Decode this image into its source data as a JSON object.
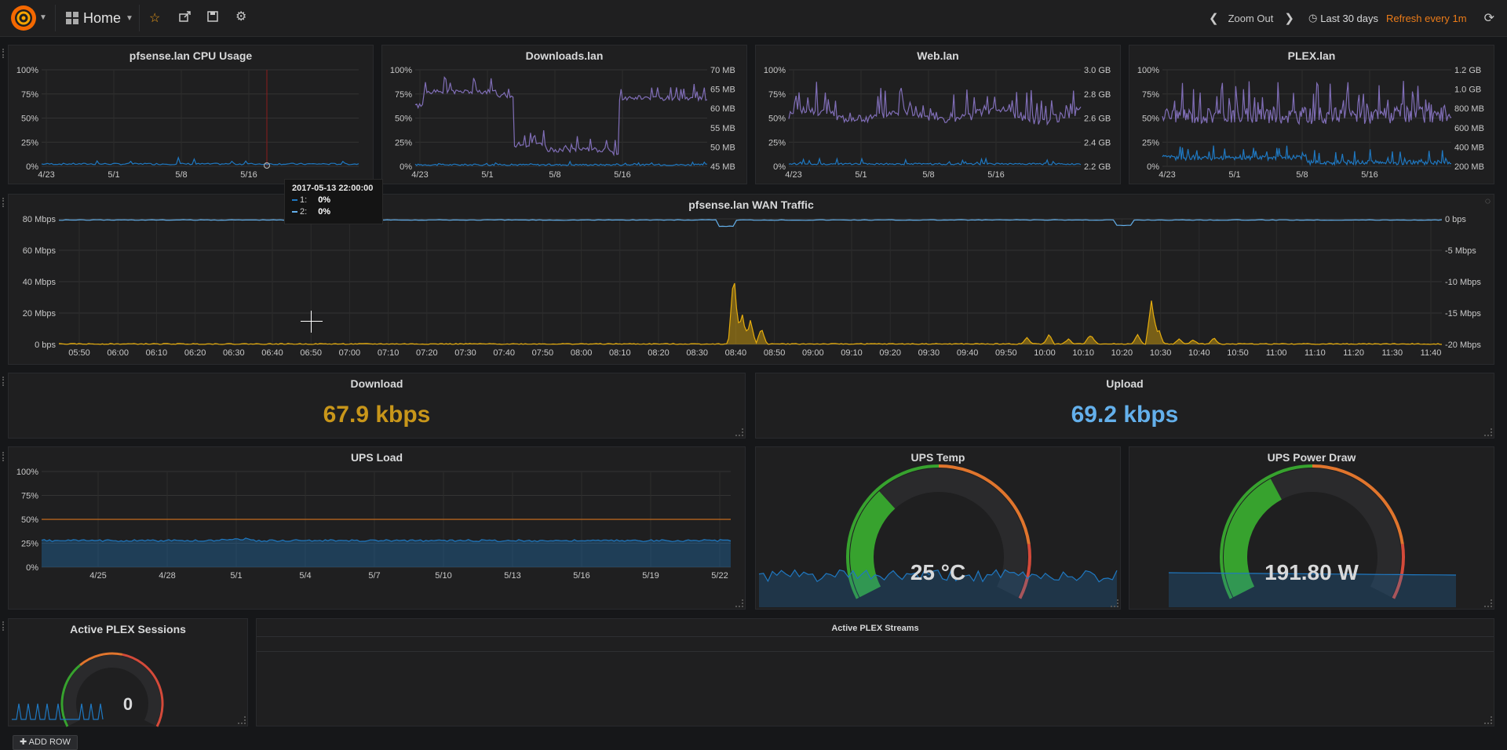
{
  "nav": {
    "dashboard_title": "Home",
    "zoom_out_label": "Zoom Out",
    "time_range": "Last 30 days",
    "refresh": "Refresh every 1m"
  },
  "icons": {
    "logo": "grafana-logo",
    "star": "star-icon",
    "share": "share-icon",
    "save": "save-icon",
    "settings": "gear-icon",
    "prev": "chevron-left-icon",
    "next": "chevron-right-icon",
    "clock": "clock-icon",
    "reload": "refresh-icon"
  },
  "colors": {
    "background": "#161719",
    "panel": "#1f1f20",
    "blue": "#1f78c1",
    "light_blue": "#64b0eb",
    "purple": "#806eb7",
    "yellow": "#e5ac0e",
    "orange": "#eb7b18",
    "gauge_green": "#37a22e",
    "gauge_orange": "#e0752d",
    "gauge_red": "#d44a3a",
    "download_stat": "#c8961a",
    "upload_stat": "#64b0eb"
  },
  "panels": {
    "cpu": {
      "title": "pfsense.lan CPU Usage",
      "y_ticks": [
        "100%",
        "75%",
        "50%",
        "25%",
        "0%"
      ],
      "x_ticks": [
        "4/23",
        "5/1",
        "5/8",
        "5/16"
      ]
    },
    "downloads": {
      "title": "Downloads.lan",
      "y_ticks": [
        "100%",
        "75%",
        "50%",
        "25%",
        "0%"
      ],
      "y2_ticks": [
        "70 MB",
        "65 MB",
        "60 MB",
        "55 MB",
        "50 MB",
        "45 MB"
      ],
      "x_ticks": [
        "4/23",
        "5/1",
        "5/8",
        "5/16"
      ]
    },
    "web": {
      "title": "Web.lan",
      "y_ticks": [
        "100%",
        "75%",
        "50%",
        "25%",
        "0%"
      ],
      "y2_ticks": [
        "3.0 GB",
        "2.8 GB",
        "2.6 GB",
        "2.4 GB",
        "2.2 GB"
      ],
      "x_ticks": [
        "4/23",
        "5/1",
        "5/8",
        "5/16"
      ]
    },
    "plex": {
      "title": "PLEX.lan",
      "y_ticks": [
        "100%",
        "75%",
        "50%",
        "25%",
        "0%"
      ],
      "y2_ticks": [
        "1.2 GB",
        "1.0 GB",
        "800 MB",
        "600 MB",
        "400 MB",
        "200 MB"
      ],
      "x_ticks": [
        "4/23",
        "5/1",
        "5/8",
        "5/16"
      ]
    },
    "wan": {
      "title": "pfsense.lan WAN Traffic",
      "y_ticks": [
        "80 Mbps",
        "60 Mbps",
        "40 Mbps",
        "20 Mbps",
        "0 bps"
      ],
      "y2_ticks": [
        "0 bps",
        "-5 Mbps",
        "-10 Mbps",
        "-15 Mbps",
        "-20 Mbps"
      ],
      "x_ticks": [
        "05:50",
        "06:00",
        "06:10",
        "06:20",
        "06:30",
        "06:40",
        "06:50",
        "07:00",
        "07:10",
        "07:20",
        "07:30",
        "07:40",
        "07:50",
        "08:00",
        "08:10",
        "08:20",
        "08:30",
        "08:40",
        "08:50",
        "09:00",
        "09:10",
        "09:20",
        "09:30",
        "09:40",
        "09:50",
        "10:00",
        "10:10",
        "10:20",
        "10:30",
        "10:40",
        "10:50",
        "11:00",
        "11:10",
        "11:20",
        "11:30",
        "11:40"
      ]
    },
    "download": {
      "title": "Download",
      "value": "67.9 kbps"
    },
    "upload": {
      "title": "Upload",
      "value": "69.2 kbps"
    },
    "ups_load": {
      "title": "UPS Load",
      "y_ticks": [
        "100%",
        "75%",
        "50%",
        "25%",
        "0%"
      ],
      "x_ticks": [
        "4/25",
        "4/28",
        "5/1",
        "5/4",
        "5/7",
        "5/10",
        "5/13",
        "5/16",
        "5/19",
        "5/22"
      ],
      "threshold_percent": 50,
      "level_percent": 27
    },
    "ups_temp": {
      "title": "UPS Temp",
      "value": "25 °C",
      "gauge_fraction": 0.32
    },
    "ups_power": {
      "title": "UPS Power Draw",
      "value": "191.80 W",
      "gauge_fraction": 0.38
    },
    "plex_sessions": {
      "title": "Active PLEX Sessions",
      "value": "0"
    },
    "plex_streams": {
      "title": "Active PLEX Streams"
    }
  },
  "tooltip": {
    "time": "2017-05-13 22:00:00",
    "rows": [
      {
        "label": "1:",
        "value": "0%"
      },
      {
        "label": "2:",
        "value": "0%"
      }
    ]
  },
  "add_row_label": "ADD ROW"
}
